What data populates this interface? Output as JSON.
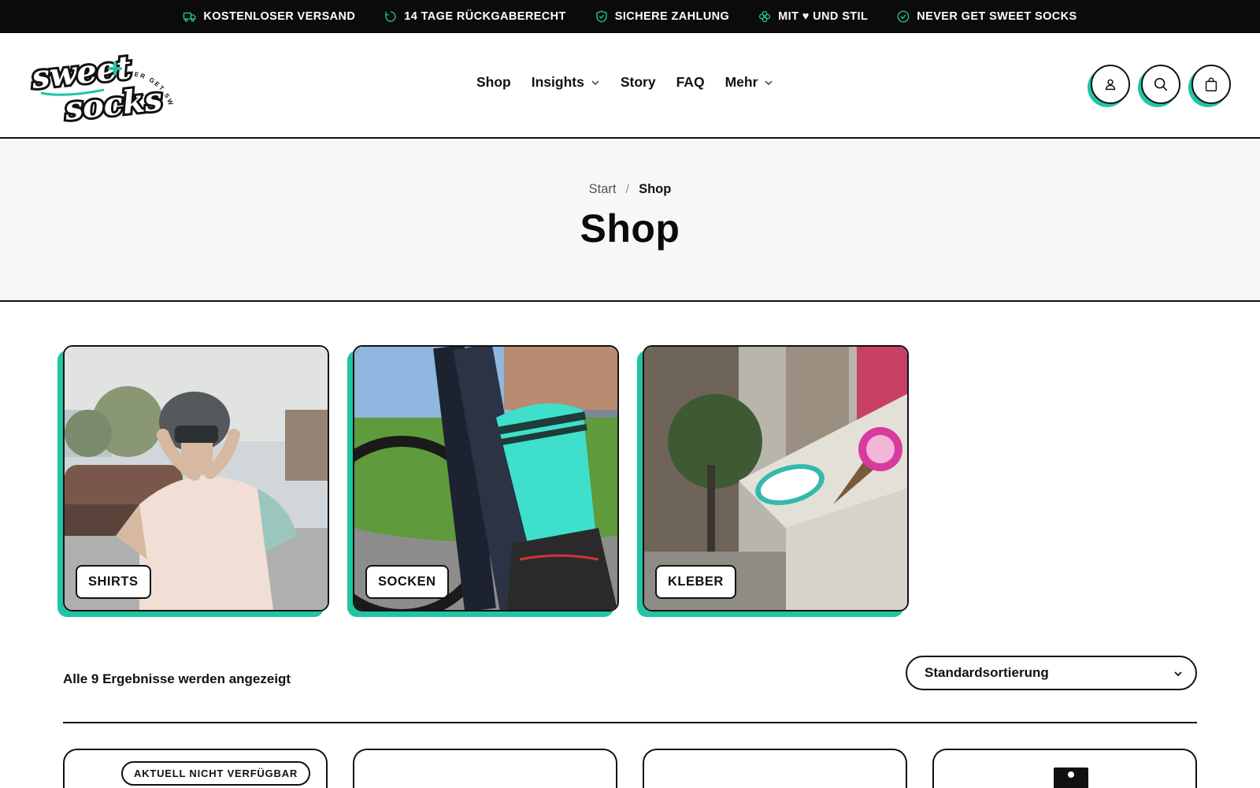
{
  "topbar": {
    "items": [
      {
        "icon": "truck-icon",
        "label": "KOSTENLOSER VERSAND"
      },
      {
        "icon": "return-arrow-icon",
        "label": "14 TAGE RÜCKGABERECHT"
      },
      {
        "icon": "shield-check-icon",
        "label": "SICHERE ZAHLUNG"
      },
      {
        "icon": "clover-icon",
        "label": "MIT ♥ UND STIL"
      },
      {
        "icon": "check-circle-icon",
        "label": "NEVER GET SWEET SOCKS"
      }
    ]
  },
  "header": {
    "logo": {
      "line1": "sweet",
      "line2": "socks",
      "ring_text": "NEVER GET SWEET SOCKS"
    },
    "nav": [
      {
        "label": "Shop",
        "has_dropdown": false
      },
      {
        "label": "Insights",
        "has_dropdown": true
      },
      {
        "label": "Story",
        "has_dropdown": false
      },
      {
        "label": "FAQ",
        "has_dropdown": false
      },
      {
        "label": "Mehr",
        "has_dropdown": true
      }
    ],
    "actions": [
      {
        "icon": "user-icon"
      },
      {
        "icon": "search-icon"
      },
      {
        "icon": "shopping-bag-icon"
      }
    ]
  },
  "hero": {
    "breadcrumb": {
      "start": "Start",
      "separator": "/",
      "current": "Shop"
    },
    "title": "Shop"
  },
  "categories": [
    {
      "label": "SHIRTS"
    },
    {
      "label": "SOCKEN"
    },
    {
      "label": "KLEBER"
    }
  ],
  "results": {
    "count_text": "Alle 9 Ergebnisse werden angezeigt",
    "sort_selected": "Standardsortierung"
  },
  "products": {
    "badge": "AKTUELL NICHT VERFÜGBAR"
  },
  "colors": {
    "accent": "#21c4a3",
    "dark": "#0b0b0b",
    "hero_bg": "#f6f7f9"
  }
}
